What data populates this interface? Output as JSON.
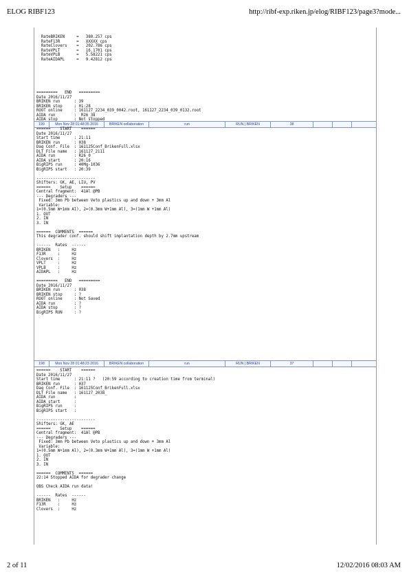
{
  "header": {
    "left": "ELOG RIBF123",
    "right": "http://ribf-exp.riken.jp/elog/RIBF123/page3?mode..."
  },
  "footer": {
    "left": "2 of 11",
    "right": "12/02/2016 08:03 AM"
  },
  "entry_top": {
    "rates_and_end": "  RateBRIKEN     =   380.257 cps\n  RateF13R       =   XXXXX cps\n  RateClovers    =   202.786 cps\n  RateVPLT       =   16.1701 cps\n  RateVPLB       =   5.58221 cps\n  RateAIDAPL     =   9.42812 cps",
    "end_block": "=========   END   =========\nDate 2016/11/27\nBRIKEN run      : 39\nBRIKEN stop     : 01:28\nROOT online     : 161127_2234_039_0042.root, 161127_2234_039_0132.root\nAIDA run        :  R26_38\nAIDA stop       : Not stopped\nBigRIPS RUN     : 1040"
  },
  "entries": [
    {
      "id": "199",
      "date": "Mon Nov 28 01:48:35 2016",
      "author": "BRIKEN collaboration",
      "type": "run",
      "category": "RUN | BRIKEN",
      "subject": "38",
      "body": "======    START    ======\nDate 2016/11/27\nStart time      : 21:11\nBRIKEN run      : 038\nDaq Conf. File  : 161125Conf_BrikenFull.xlsx\nDLT File name   : 161127_2111\nAIDA run        : R26_0\nAIDA start      : 20:16\nBigRIPS run     : 40Mg-1036\nBigRIPS start   : 20:39\n\n-------------------------\nShifters: GK, AE, LIU, PV\n======    Setup    ======\nCentral fragment:  41Al @PB\n--- Degraders ---\n Fixed: 3mm Pb between Veto plastics up and down + 3mm Al\n Variable:\n1=(0.5mm W+1mm Al), 2=(0.3mm W+1mm Al), 3=(1mm W +1mm Al)\n1. OUT\n2. IN\n3. IN\n\n======  COMMENTS  ======\nThis degrader conf. should shift implantation depth by 2.7mm upstream\n\n------  Rates  ------\nBRIKEN   :     Hz\nF13R     :     Hz\nClovers  :     Hz\nVPLT     :     Hz\nVPLB     :     Hz\nAIDAPL   :     Hz\n\n=========   END   =========\nDate 2016/11/27\nBRIKEN run      : 038\nBRIKEN stop     : ?\nROOT online     : Not Saved\nAIDA run        : ?\nAIDA stop       : ?\nBigRIPS RUN     : ?"
    },
    {
      "id": "198",
      "date": "Mon Nov 28 01:48:23 2016",
      "author": "BRIKEN collaboration",
      "type": "run",
      "category": "RUN | BRIKEN",
      "subject": "37",
      "body": "======    START    ======\nDate 2016/11/27\nStart time      : 21:11 ?   (20:59 according to creation time from terminal)\nBRIKEN run      : 037\nDaq Conf. File  : 161125Conf_BrikenFull.xlsx\nDLT File name   : 161127_2038_\nAIDA run        :\nAIDA start      :\nBigRIPS run     :\nBigRIPS start   :\n\n-------------------------\nShifters: GK, AE\n======    Setup    ======\nCentral fragment:  41Al @PB\n--- Degraders ---\n Fixed: 3mm Pb between Veto plastics up and down + 3mm Al\n Variable:\n1=(0.5mm W+1mm Al), 2=(0.3mm W+1mm Al), 3=(1mm W +1mm Al)\n1. OUT\n2. IN\n3. IN\n\n======  COMMENTS  ======\n22:14 Stopped AIDA for degrader change\n\nOBS Check AIDA run data!\n\n------  Rates  ------\nBRIKEN   :     Hz\nF13R     :     Hz\nClovers  :     Hz"
    }
  ]
}
